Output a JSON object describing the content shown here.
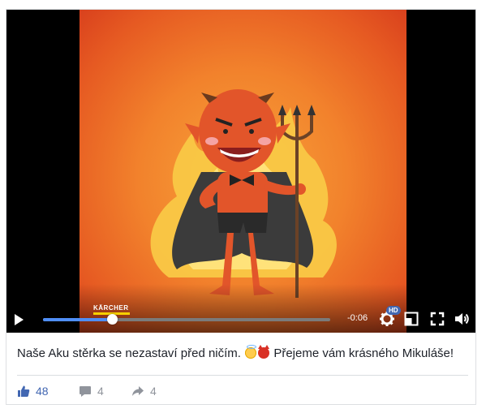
{
  "video": {
    "watermark": "KÄRCHER",
    "time_remaining": "-0:06",
    "progress": 0.24,
    "quality_badge": "HD",
    "accent_color": "#4f8ef7",
    "icons": [
      "play-icon",
      "settings-gear-icon",
      "mini-player-icon",
      "fullscreen-icon",
      "volume-icon"
    ]
  },
  "post": {
    "caption_text": "Naše Aku stěrka se nezastaví před ničím.",
    "caption_emojis": [
      "smiling-face-with-halo",
      "smiling-face-with-horns"
    ],
    "caption_tail": "Přejeme vám krásného Mikuláše!"
  },
  "stats": {
    "likes": "48",
    "comments": "4",
    "shares": "4",
    "like_color": "#4267b2"
  }
}
